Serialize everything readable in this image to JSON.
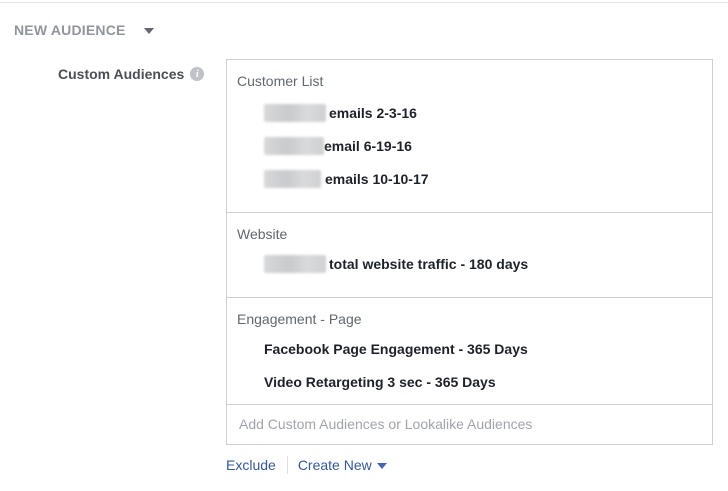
{
  "header": {
    "title": "NEW AUDIENCE",
    "caret_icon": "caret-down-icon"
  },
  "field": {
    "label": "Custom Audiences",
    "info_icon": "info-icon",
    "info_glyph": "i"
  },
  "sections": [
    {
      "title": "Customer List",
      "items": [
        {
          "text": "emails 2-3-16",
          "redacted": true
        },
        {
          "text": "email 6-19-16",
          "redacted": true
        },
        {
          "text": "emails 10-10-17",
          "redacted": true
        }
      ]
    },
    {
      "title": "Website",
      "items": [
        {
          "text": "total website traffic - 180 days",
          "redacted": true
        }
      ]
    },
    {
      "title": "Engagement - Page",
      "items": [
        {
          "text": "Facebook Page Engagement - 365 Days",
          "redacted": false
        },
        {
          "text": "Video Retargeting 3 sec - 365 Days",
          "redacted": false
        }
      ]
    }
  ],
  "search": {
    "placeholder": "Add Custom Audiences or Lookalike Audiences",
    "value": ""
  },
  "footer": {
    "exclude_label": "Exclude",
    "create_new_label": "Create New"
  },
  "colors": {
    "link": "#365899",
    "border": "#ccd0d5",
    "header": "#90949c"
  }
}
